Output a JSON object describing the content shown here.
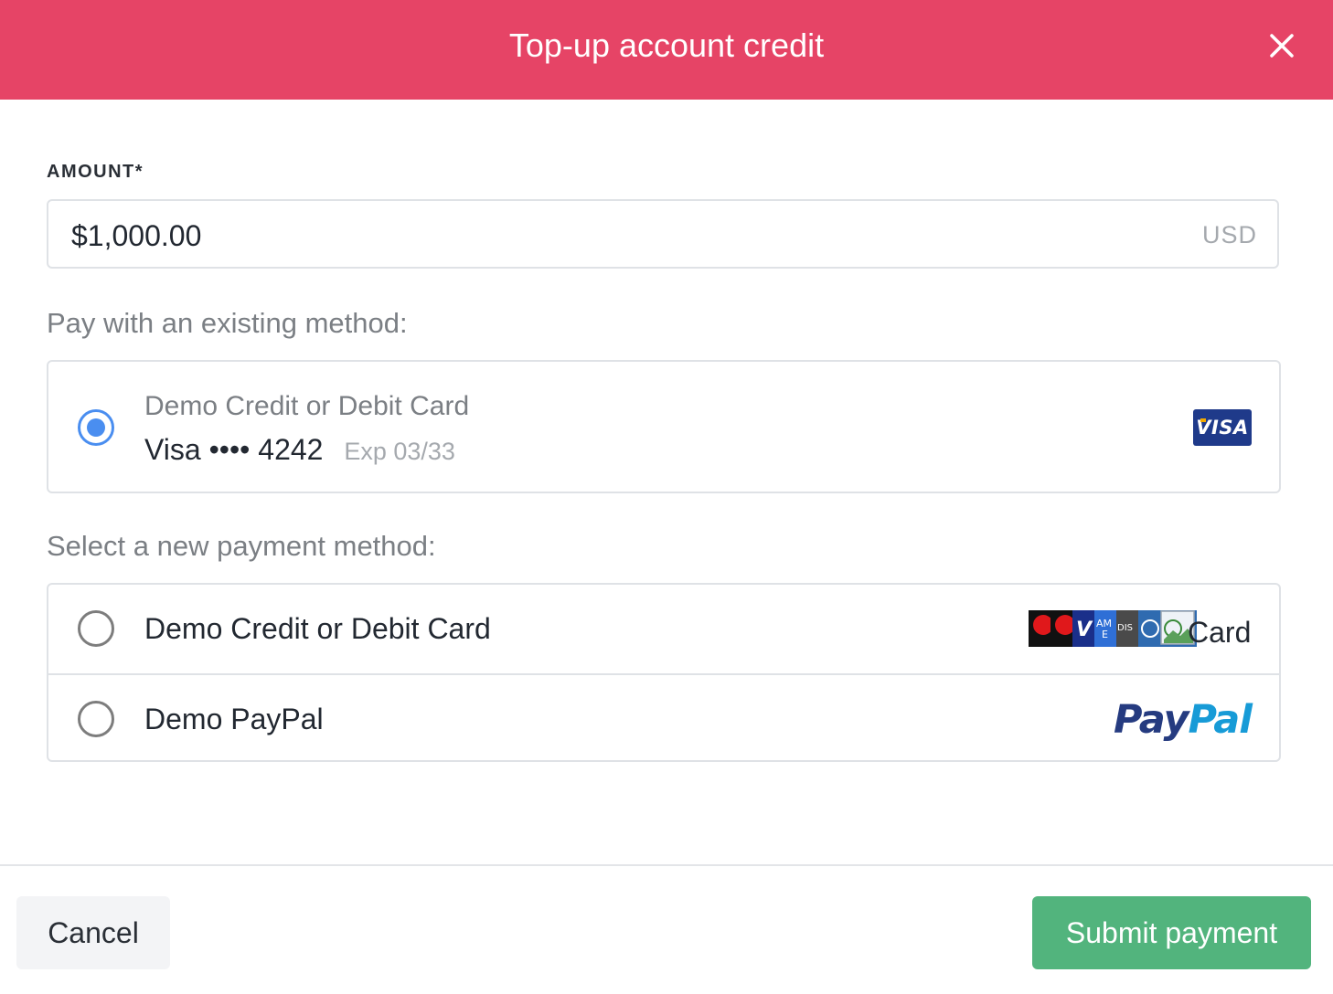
{
  "modal": {
    "title": "Top-up account credit"
  },
  "amount": {
    "label": "AMOUNT*",
    "value": "$1,000.00",
    "currency": "USD"
  },
  "existing_methods": {
    "heading": "Pay with an existing method:",
    "items": [
      {
        "name": "Demo Credit or Debit Card",
        "card_summary": "Visa •••• 4242",
        "expiry": "Exp 03/33",
        "brand_logo": "VISA",
        "selected": true
      }
    ]
  },
  "new_methods": {
    "heading": "Select a new payment method:",
    "items": [
      {
        "name": "Demo Credit or Debit Card",
        "trailing_text": "Card",
        "icons": [
          "mastercard-icon",
          "maestro-icon",
          "visa-icon",
          "amex-icon",
          "discover-icon",
          "diners-icon",
          "broken-image-icon"
        ],
        "selected": false
      },
      {
        "name": "Demo PayPal",
        "logo_dark": "Pay",
        "logo_light": "Pal",
        "selected": false
      }
    ]
  },
  "footer": {
    "cancel_label": "Cancel",
    "submit_label": "Submit payment"
  },
  "colors": {
    "header": "#e64466",
    "radio_selected": "#4a8ef0",
    "submit": "#52b47d",
    "paypal_dark": "#253b80",
    "paypal_light": "#179bd7",
    "visa_blue": "#1f3a8a"
  }
}
